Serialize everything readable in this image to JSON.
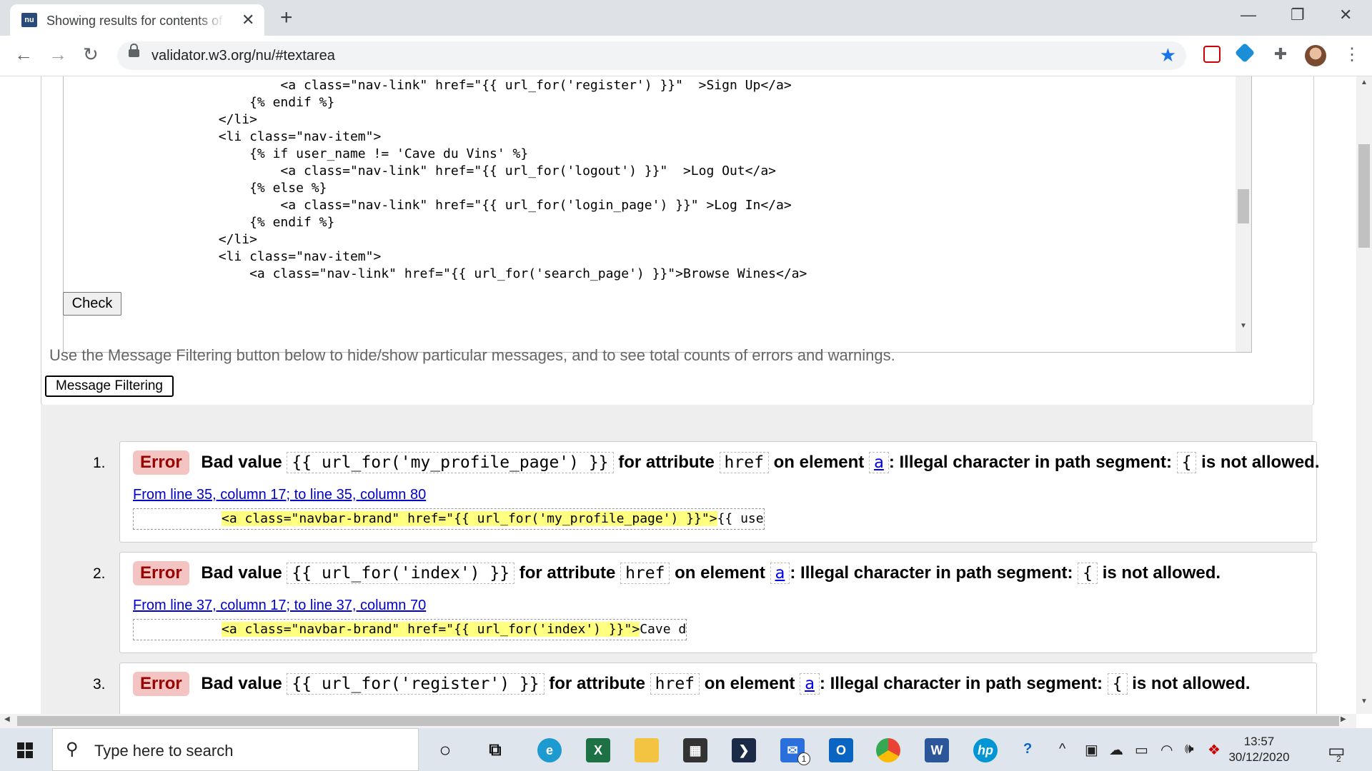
{
  "browser": {
    "tab_title": "Showing results for contents of text-input area",
    "favicon_text": "nu",
    "url": "validator.w3.org/nu/#textarea",
    "window_controls": {
      "minimize": "—",
      "restore": "❐",
      "close": "✕"
    }
  },
  "form": {
    "textarea_lines": [
      "                            <a class=\"nav-link\" href=\"{{ url_for('register') }}\"  >Sign Up</a>",
      "                        {% endif %}",
      "                    </li>",
      "                    <li class=\"nav-item\">",
      "                        {% if user_name != 'Cave du Vins' %}",
      "                            <a class=\"nav-link\" href=\"{{ url_for('logout') }}\"  >Log Out</a>",
      "                        {% else %}",
      "                            <a class=\"nav-link\" href=\"{{ url_for('login_page') }}\" >Log In</a>",
      "                        {% endif %}",
      "                    </li>",
      "                    <li class=\"nav-item\">",
      "                        <a class=\"nav-link\" href=\"{{ url_for('search_page') }}\">Browse Wines</a>"
    ],
    "check_label": "Check"
  },
  "hint": "Use the Message Filtering button below to hide/show particular messages, and to see total counts of errors and warnings.",
  "filter_label": "Message Filtering",
  "messages": [
    {
      "number": "1.",
      "type": "Error",
      "prefix": "Bad value",
      "value": "{{ url_for('my_profile_page') }}",
      "for_attr": "for attribute",
      "attr": "href",
      "on_element": "on element",
      "element": "a",
      "reason": ": Illegal character in path segment:",
      "char": "{",
      "suffix": "is not allowed.",
      "location": "From line 35, column 17; to line 35, column 80",
      "extract_hl": "<a class=\"navbar-brand\" href=\"{{ url_for('my_profile_page') }}\">",
      "extract_rest": "{{ use"
    },
    {
      "number": "2.",
      "type": "Error",
      "prefix": "Bad value",
      "value": "{{ url_for('index') }}",
      "for_attr": "for attribute",
      "attr": "href",
      "on_element": "on element",
      "element": "a",
      "reason": ": Illegal character in path segment:",
      "char": "{",
      "suffix": "is not allowed.",
      "location": "From line 37, column 17; to line 37, column 70",
      "extract_hl": "<a class=\"navbar-brand\" href=\"{{ url_for('index') }}\">",
      "extract_rest": "Cave d"
    },
    {
      "number": "3.",
      "type": "Error",
      "prefix": "Bad value",
      "value": "{{ url_for('register') }}",
      "for_attr": "for attribute",
      "attr": "href",
      "on_element": "on element",
      "element": "a",
      "reason": ": Illegal character in path segment:",
      "char": "{",
      "suffix": "is not allowed."
    }
  ],
  "taskbar": {
    "search_placeholder": "Type here to search",
    "time": "13:57",
    "date": "30/12/2020",
    "mail_badge": "1",
    "notification_count": "2"
  },
  "colors": {
    "error_bg": "#f4c4c2",
    "highlight": "#ffff80",
    "link": "#0000ee",
    "star": "#1a73e8"
  }
}
